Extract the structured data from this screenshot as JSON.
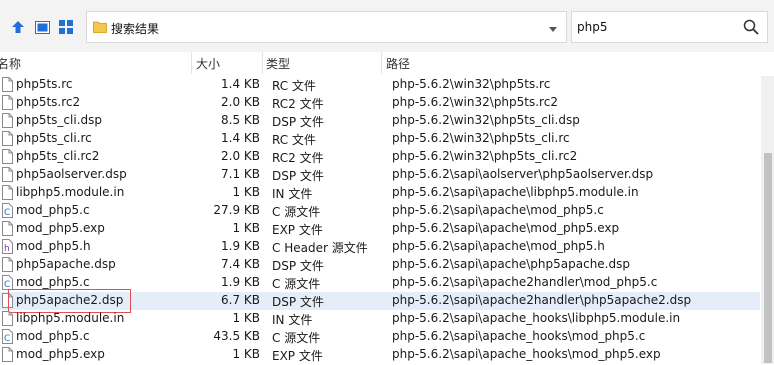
{
  "address": {
    "path": "搜索结果"
  },
  "search": {
    "value": "php5"
  },
  "columns": {
    "name": "名称",
    "size": "大小",
    "type": "类型",
    "path": "路径"
  },
  "rows": [
    {
      "name": "php5ts.rc",
      "size": "1.4 KB",
      "type": "RC 文件",
      "path": "php-5.6.2\\win32\\php5ts.rc",
      "icon": "doc"
    },
    {
      "name": "php5ts.rc2",
      "size": "2.0 KB",
      "type": "RC2 文件",
      "path": "php-5.6.2\\win32\\php5ts.rc2",
      "icon": "doc"
    },
    {
      "name": "php5ts_cli.dsp",
      "size": "8.5 KB",
      "type": "DSP 文件",
      "path": "php-5.6.2\\win32\\php5ts_cli.dsp",
      "icon": "doc"
    },
    {
      "name": "php5ts_cli.rc",
      "size": "1.4 KB",
      "type": "RC 文件",
      "path": "php-5.6.2\\win32\\php5ts_cli.rc",
      "icon": "doc"
    },
    {
      "name": "php5ts_cli.rc2",
      "size": "2.0 KB",
      "type": "RC2 文件",
      "path": "php-5.6.2\\win32\\php5ts_cli.rc2",
      "icon": "doc"
    },
    {
      "name": "php5aolserver.dsp",
      "size": "7.1 KB",
      "type": "DSP 文件",
      "path": "php-5.6.2\\sapi\\aolserver\\php5aolserver.dsp",
      "icon": "doc"
    },
    {
      "name": "libphp5.module.in",
      "size": "1 KB",
      "type": "IN 文件",
      "path": "php-5.6.2\\sapi\\apache\\libphp5.module.in",
      "icon": "doc"
    },
    {
      "name": "mod_php5.c",
      "size": "27.9 KB",
      "type": "C 源文件",
      "path": "php-5.6.2\\sapi\\apache\\mod_php5.c",
      "icon": "c"
    },
    {
      "name": "mod_php5.exp",
      "size": "1 KB",
      "type": "EXP 文件",
      "path": "php-5.6.2\\sapi\\apache\\mod_php5.exp",
      "icon": "doc"
    },
    {
      "name": "mod_php5.h",
      "size": "1.9 KB",
      "type": "C Header 源文件",
      "path": "php-5.6.2\\sapi\\apache\\mod_php5.h",
      "icon": "h"
    },
    {
      "name": "php5apache.dsp",
      "size": "7.4 KB",
      "type": "DSP 文件",
      "path": "php-5.6.2\\sapi\\apache\\php5apache.dsp",
      "icon": "doc"
    },
    {
      "name": "mod_php5.c",
      "size": "1.9 KB",
      "type": "C 源文件",
      "path": "php-5.6.2\\sapi\\apache2handler\\mod_php5.c",
      "icon": "c"
    },
    {
      "name": "php5apache2.dsp",
      "size": "6.7 KB",
      "type": "DSP 文件",
      "path": "php-5.6.2\\sapi\\apache2handler\\php5apache2.dsp",
      "icon": "doc",
      "selected": true
    },
    {
      "name": "libphp5.module.in",
      "size": "1 KB",
      "type": "IN 文件",
      "path": "php-5.6.2\\sapi\\apache_hooks\\libphp5.module.in",
      "icon": "doc"
    },
    {
      "name": "mod_php5.c",
      "size": "43.5 KB",
      "type": "C 源文件",
      "path": "php-5.6.2\\sapi\\apache_hooks\\mod_php5.c",
      "icon": "c"
    },
    {
      "name": "mod_php5.exp",
      "size": "1 KB",
      "type": "EXP 文件",
      "path": "php-5.6.2\\sapi\\apache_hooks\\mod_php5.exp",
      "icon": "doc"
    }
  ]
}
